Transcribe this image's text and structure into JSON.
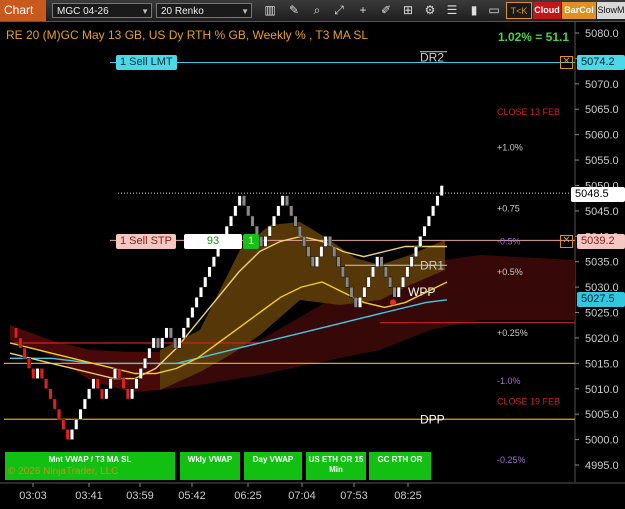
{
  "toolbar": {
    "title": "Chart",
    "instrument": "MGC 04-26",
    "bar_type": "20 Renko",
    "icons": [
      "bar-chart-icon",
      "zoom-icon",
      "crosshair-icon",
      "draw-icon",
      "pencil-icon",
      "grid-icon",
      "properties-icon",
      "list-icon",
      "sidebar-icon"
    ],
    "buttons": [
      {
        "label": "T<K",
        "color": "#e09020"
      },
      {
        "label": "Cloud",
        "color": "#c01818"
      },
      {
        "label": "BarCol",
        "color": "#e09020"
      },
      {
        "label": "SlowM",
        "color": "#d8d8d8"
      }
    ]
  },
  "chart_header": "RE 20  (M)GC May 13 GB, US Dy RTH % GB, Weekly % , T3 MA SL",
  "pct_readout": "1.02% = 51.1",
  "orders": {
    "sell_lmt": {
      "label": "1 Sell LMT",
      "price": "5074.2"
    },
    "sell_stp": {
      "label": "1 Sell STP",
      "price": "5039.2",
      "ticks": "93",
      "qty": "1"
    }
  },
  "last_price": "5048.5",
  "vwap_price": "5027.5",
  "close_icon": "x-close-icon",
  "chart_data": {
    "type": "line",
    "title": "",
    "ylim": [
      4992,
      5082
    ],
    "y_ticks": [
      5080.0,
      5075.0,
      5070.0,
      5065.0,
      5060.0,
      5055.0,
      5050.0,
      5045.0,
      5040.0,
      5035.0,
      5030.0,
      5025.0,
      5020.0,
      5015.0,
      5010.0,
      5005.0,
      5000.0,
      4995.0
    ],
    "y_tick_labels": [
      "5080.0",
      "5075.0",
      "5070.0",
      "5065.0",
      "5060.0",
      "5055.0",
      "5050.0",
      "5045.0",
      "5040.0",
      "5035.0",
      "5030.0",
      "5025.0",
      "5020.0",
      "5015.0",
      "5010.0",
      "5005.0",
      "5000.0",
      "4995.0"
    ],
    "x_tick_labels": [
      "03:03",
      "03:41",
      "03:59",
      "05:42",
      "06:25",
      "07:04",
      "07:53",
      "08:25"
    ],
    "price_levels": [
      {
        "label": "DR2",
        "value": 5075.2,
        "color": "#cccccc"
      },
      {
        "label": "DR1",
        "value": 5034.3,
        "color": "#cccccc"
      },
      {
        "label": "WPP",
        "value": 5029.0,
        "color": "#ffffff"
      },
      {
        "label": "DPP",
        "value": 5004.0,
        "color": "#ffffff"
      }
    ],
    "annotations": [
      {
        "text": "CLOSE 13 FEB",
        "value": 5064.5,
        "color": "#d02020"
      },
      {
        "text": "+1.0%",
        "value": 5057.5,
        "color": "#cccccc"
      },
      {
        "text": "+0.75",
        "value": 5045.5,
        "color": "#cccccc"
      },
      {
        "text": "-0.5%",
        "value": 5039.0,
        "color": "#a070d0"
      },
      {
        "text": "+0.5%",
        "value": 5033.0,
        "color": "#cccccc"
      },
      {
        "text": "+0.25%",
        "value": 5021.0,
        "color": "#cccccc"
      },
      {
        "text": "-1.0%",
        "value": 5011.5,
        "color": "#a070d0"
      },
      {
        "text": "CLOSE 19 FEB",
        "value": 5007.5,
        "color": "#d02020"
      },
      {
        "text": "-0.25%",
        "value": 4996.0,
        "color": "#a070d0"
      }
    ],
    "renko_close_series": [
      5022,
      5020,
      5018,
      5016,
      5014,
      5012,
      5014,
      5012,
      5010,
      5008,
      5006,
      5004,
      5002,
      5000,
      5002,
      5004,
      5006,
      5008,
      5010,
      5012,
      5010,
      5008,
      5010,
      5012,
      5014,
      5012,
      5010,
      5008,
      5010,
      5012,
      5014,
      5016,
      5018,
      5020,
      5018,
      5020,
      5022,
      5020,
      5018,
      5020,
      5022,
      5024,
      5026,
      5028,
      5030,
      5032,
      5034,
      5036,
      5038,
      5040,
      5042,
      5044,
      5046,
      5048,
      5046,
      5044,
      5042,
      5040,
      5038,
      5040,
      5042,
      5044,
      5046,
      5048,
      5046,
      5044,
      5042,
      5040,
      5038,
      5036,
      5034,
      5036,
      5038,
      5040,
      5038,
      5036,
      5034,
      5032,
      5030,
      5028,
      5026,
      5028,
      5030,
      5032,
      5034,
      5036,
      5034,
      5032,
      5030,
      5028,
      5030,
      5032,
      5034,
      5036,
      5038,
      5040,
      5042,
      5044,
      5046,
      5048,
      5050
    ],
    "series": [
      {
        "color": "#40c8e8",
        "values": [
          5016,
          5016,
          5016,
          5015.5,
          5015,
          5015,
          5015,
          5015,
          5015,
          5016,
          5017,
          5018,
          5019,
          5020,
          5021,
          5022,
          5023,
          5024,
          5025,
          5026,
          5027,
          5027.5
        ]
      },
      {
        "color": "#f0d020",
        "values": [
          5019,
          5018,
          5017,
          5016,
          5015,
          5014,
          5013,
          5013,
          5014,
          5016,
          5019,
          5022,
          5025,
          5028,
          5030,
          5031,
          5029,
          5027,
          5026,
          5027,
          5029,
          5031
        ]
      },
      {
        "color": "#f0d070",
        "values": [
          5017,
          5016,
          5015,
          5014,
          5013,
          5012,
          5012,
          5014,
          5018,
          5023,
          5028,
          5033,
          5037,
          5039,
          5040,
          5039,
          5037,
          5036,
          5037,
          5038,
          5038,
          5038
        ]
      }
    ]
  },
  "bottom_buttons": [
    {
      "label": "Mnt VWAP / T3 MA SL"
    },
    {
      "label": "Wkly VWAP"
    },
    {
      "label": "Day VWAP"
    },
    {
      "label": "US ETH OR 15 Min"
    },
    {
      "label": "GC RTH OR"
    }
  ],
  "copyright": "© 2026 NinjaTrader, LLC"
}
